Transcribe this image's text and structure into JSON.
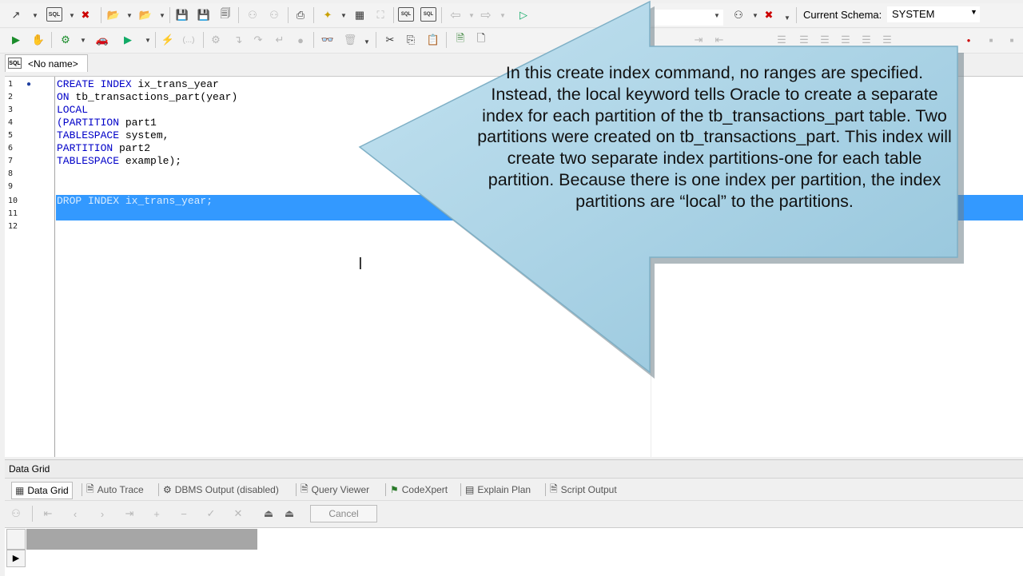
{
  "toolbar": {
    "current_schema_label": "Current Schema:",
    "current_schema_value": "SYSTEM"
  },
  "editor_tab": {
    "icon_text": "SQL",
    "label": "<No name>"
  },
  "editor": {
    "line_numbers": [
      "1",
      "2",
      "3",
      "4",
      "5",
      "6",
      "7",
      "8",
      "9",
      "10",
      "11",
      "12"
    ],
    "lines": [
      {
        "kw": "CREATE INDEX",
        "rest": " ix_trans_year"
      },
      {
        "kw": "ON",
        "rest": " tb_transactions_part(year)"
      },
      {
        "kw": "LOCAL",
        "rest": ""
      },
      {
        "kw": "(PARTITION",
        "rest": " part1"
      },
      {
        "kw": "TABLESPACE",
        "rest": " system,"
      },
      {
        "kw": "PARTITION",
        "rest": " part2"
      },
      {
        "kw": "TABLESPACE",
        "rest": " example);"
      }
    ],
    "selected_line": "DROP INDEX ix_trans_year;"
  },
  "callout": {
    "text": "In this create index command, no ranges are specified. Instead, the local keyword tells Oracle to create a separate index for each partition of the tb_transactions_part table. Two partitions were created on tb_transactions_part. This index will create two separate index partitions-one for each table partition. Because there is one index per partition, the index partitions are “local” to the partitions."
  },
  "data_grid": {
    "title": "Data Grid",
    "tabs": [
      {
        "label": "Data Grid",
        "icon": "grid-icon"
      },
      {
        "label": "Auto Trace",
        "icon": "document-icon"
      },
      {
        "label": "DBMS Output (disabled)",
        "icon": "output-icon"
      },
      {
        "label": "Query Viewer",
        "icon": "document-icon"
      },
      {
        "label": "CodeXpert",
        "icon": "codexpert-icon"
      },
      {
        "label": "Explain Plan",
        "icon": "plan-icon"
      },
      {
        "label": "Script Output",
        "icon": "document-icon"
      }
    ],
    "cancel_label": "Cancel"
  },
  "colors": {
    "selection": "#3399ff",
    "keyword": "#0000c8",
    "callout_fill": "#a9d3e6"
  }
}
